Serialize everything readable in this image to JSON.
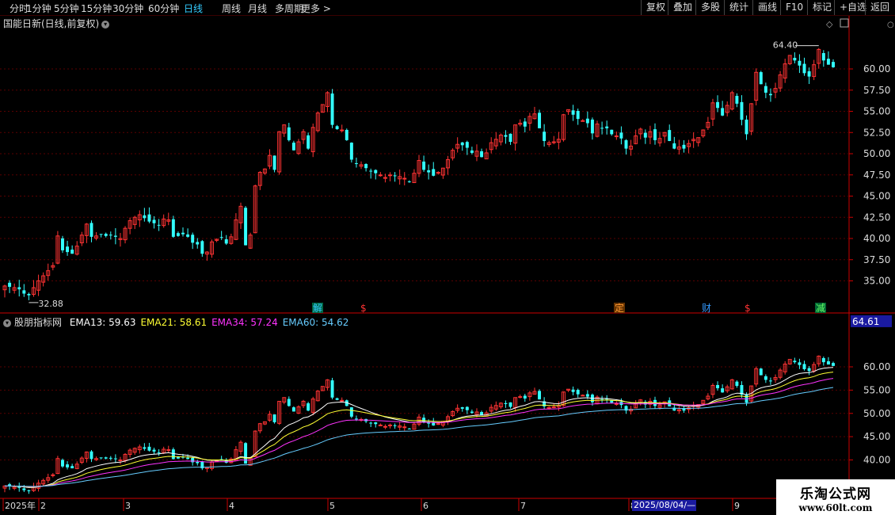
{
  "toolbar": {
    "periods": [
      "分时",
      "1分钟",
      "5分钟",
      "15分钟",
      "30分钟",
      "60分钟",
      "日线",
      "周线",
      "月线",
      "多周期",
      "更多 >"
    ],
    "active": "日线",
    "right_buttons": [
      "复权",
      "叠加",
      "多股",
      "统计",
      "画线",
      "F10",
      "标记",
      "+自选",
      "返回"
    ]
  },
  "main_title": "国能日新(日线,前复权)",
  "price_labels": [
    "60.00",
    "57.50",
    "55.00",
    "52.50",
    "50.00",
    "47.50",
    "45.00",
    "42.50",
    "40.00",
    "37.50",
    "35.00"
  ],
  "high_label": "64.40",
  "low_label": "32.88",
  "markers": [
    {
      "text": "解",
      "color": "#3cf",
      "bg": "#064"
    },
    {
      "text": "$",
      "color": "#f33",
      "bg": ""
    },
    {
      "text": "定",
      "color": "#f93",
      "bg": "#630"
    },
    {
      "text": "财",
      "color": "#39f",
      "bg": ""
    },
    {
      "text": "$",
      "color": "#f33",
      "bg": ""
    },
    {
      "text": "减",
      "color": "#6f6",
      "bg": "#063"
    }
  ],
  "indicator": {
    "name": "股朋指标网",
    "lines": [
      {
        "label": "EMA13: 59.63",
        "color": "#ffffff"
      },
      {
        "label": "EMA21: 58.61",
        "color": "#ffff33"
      },
      {
        "label": "EMA34: 57.24",
        "color": "#ff33ff"
      },
      {
        "label": "EMA60: 54.62",
        "color": "#66ccff"
      }
    ],
    "current_value": "64.61",
    "axis_labels": [
      "60.00",
      "55.00",
      "50.00",
      "45.00",
      "40.00"
    ]
  },
  "x_axis": [
    "2025年",
    "2",
    "3",
    "4",
    "5",
    "6",
    "7",
    "8",
    "9"
  ],
  "date_box": "2025/08/04/—",
  "logo": {
    "line1": "乐淘公式网",
    "line2": "www.60lt.com"
  },
  "chart_data": {
    "type": "candlestick",
    "title": "国能日新(日线,前复权)",
    "price_range": [
      32.88,
      64.4
    ],
    "closes": [
      34.4,
      34.3,
      34.2,
      34.0,
      33.5,
      33.3,
      34.2,
      35.0,
      35.6,
      36.2,
      36.8,
      40.3,
      38.6,
      38.4,
      38.2,
      39.1,
      40.4,
      41.7,
      40.2,
      40.3,
      40.5,
      40.3,
      40.4,
      40.2,
      40.0,
      41.2,
      42.1,
      42.5,
      42.8,
      42.4,
      42.0,
      41.8,
      41.6,
      42.3,
      42.2,
      40.2,
      40.3,
      40.5,
      40.2,
      39.5,
      39.3,
      38.2,
      38.4,
      39.6,
      39.9,
      40.1,
      39.4,
      40.2,
      42.2,
      43.8,
      39.2,
      40.4,
      46.2,
      47.8,
      48.2,
      49.8,
      48.1,
      52.6,
      53.4,
      51.6,
      50.4,
      51.4,
      52.6,
      50.6,
      53.1,
      54.8,
      55.8,
      57.2,
      53.4,
      52.9,
      52.8,
      51.6,
      49.3,
      48.8,
      48.7,
      48.3,
      47.9,
      47.7,
      47.5,
      47.2,
      47.5,
      47.4,
      47.3,
      47.1,
      46.7,
      47.7,
      49.2,
      48.1,
      47.8,
      47.4,
      47.8,
      48.3,
      49.3,
      50.4,
      51.1,
      51.0,
      50.7,
      50.1,
      50.3,
      49.6,
      50.1,
      51.3,
      51.7,
      52.2,
      52.0,
      51.4,
      53.4,
      53.6,
      53.2,
      54.4,
      54.7,
      53.0,
      51.5,
      51.3,
      51.4,
      51.7,
      54.6,
      55.2,
      54.6,
      54.1,
      53.9,
      53.6,
      52.4,
      53.5,
      53.0,
      53.0,
      52.3,
      52.1,
      51.8,
      50.6,
      50.9,
      52.1,
      52.9,
      51.9,
      52.6,
      51.6,
      51.8,
      52.5,
      51.5,
      50.6,
      50.8,
      50.6,
      51.2,
      51.7,
      51.9,
      52.8,
      53.7,
      56.0,
      55.4,
      54.5,
      55.7,
      57.2,
      55.9,
      54.0,
      52.3,
      55.9,
      59.6,
      58.2,
      57.2,
      56.9,
      57.7,
      59.3,
      60.6,
      61.6,
      61.0,
      60.4,
      59.5,
      59.1,
      60.5,
      62.3,
      61.0,
      60.5,
      60.2
    ]
  }
}
